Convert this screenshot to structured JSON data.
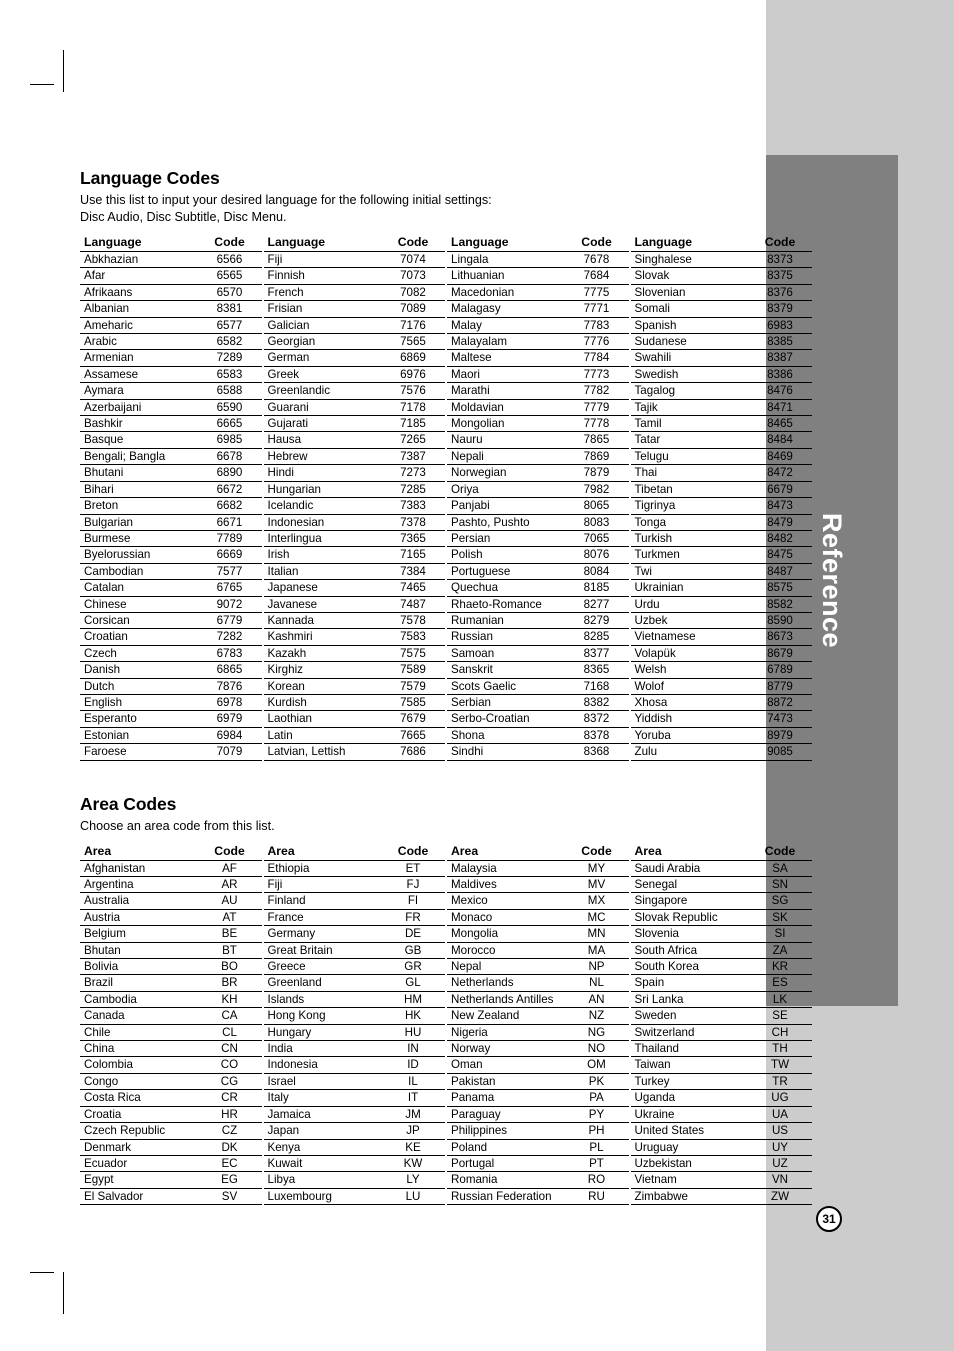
{
  "sidebar": {
    "tab_label": "Reference",
    "page_number": "31"
  },
  "language_section": {
    "title": "Language Codes",
    "description_line1": "Use this list to input your desired language for the following initial settings:",
    "description_line2": "Disc Audio, Disc Subtitle, Disc Menu.",
    "header_name": "Language",
    "header_code": "Code",
    "columns": [
      [
        [
          "Abkhazian",
          "6566"
        ],
        [
          "Afar",
          "6565"
        ],
        [
          "Afrikaans",
          "6570"
        ],
        [
          "Albanian",
          "8381"
        ],
        [
          "Ameharic",
          "6577"
        ],
        [
          "Arabic",
          "6582"
        ],
        [
          "Armenian",
          "7289"
        ],
        [
          "Assamese",
          "6583"
        ],
        [
          "Aymara",
          "6588"
        ],
        [
          "Azerbaijani",
          "6590"
        ],
        [
          "Bashkir",
          "6665"
        ],
        [
          "Basque",
          "6985"
        ],
        [
          "Bengali; Bangla",
          "6678"
        ],
        [
          "Bhutani",
          "6890"
        ],
        [
          "Bihari",
          "6672"
        ],
        [
          "Breton",
          "6682"
        ],
        [
          "Bulgarian",
          "6671"
        ],
        [
          "Burmese",
          "7789"
        ],
        [
          "Byelorussian",
          "6669"
        ],
        [
          "Cambodian",
          "7577"
        ],
        [
          "Catalan",
          "6765"
        ],
        [
          "Chinese",
          "9072"
        ],
        [
          "Corsican",
          "6779"
        ],
        [
          "Croatian",
          "7282"
        ],
        [
          "Czech",
          "6783"
        ],
        [
          "Danish",
          "6865"
        ],
        [
          "Dutch",
          "7876"
        ],
        [
          "English",
          "6978"
        ],
        [
          "Esperanto",
          "6979"
        ],
        [
          "Estonian",
          "6984"
        ],
        [
          "Faroese",
          "7079"
        ]
      ],
      [
        [
          "Fiji",
          "7074"
        ],
        [
          "Finnish",
          "7073"
        ],
        [
          "French",
          "7082"
        ],
        [
          "Frisian",
          "7089"
        ],
        [
          "Galician",
          "7176"
        ],
        [
          "Georgian",
          "7565"
        ],
        [
          "German",
          "6869"
        ],
        [
          "Greek",
          "6976"
        ],
        [
          "Greenlandic",
          "7576"
        ],
        [
          "Guarani",
          "7178"
        ],
        [
          "Gujarati",
          "7185"
        ],
        [
          "Hausa",
          "7265"
        ],
        [
          "Hebrew",
          "7387"
        ],
        [
          "Hindi",
          "7273"
        ],
        [
          "Hungarian",
          "7285"
        ],
        [
          "Icelandic",
          "7383"
        ],
        [
          "Indonesian",
          "7378"
        ],
        [
          "Interlingua",
          "7365"
        ],
        [
          "Irish",
          "7165"
        ],
        [
          "Italian",
          "7384"
        ],
        [
          "Japanese",
          "7465"
        ],
        [
          "Javanese",
          "7487"
        ],
        [
          "Kannada",
          "7578"
        ],
        [
          "Kashmiri",
          "7583"
        ],
        [
          "Kazakh",
          "7575"
        ],
        [
          "Kirghiz",
          "7589"
        ],
        [
          "Korean",
          "7579"
        ],
        [
          "Kurdish",
          "7585"
        ],
        [
          "Laothian",
          "7679"
        ],
        [
          "Latin",
          "7665"
        ],
        [
          "Latvian, Lettish",
          "7686"
        ]
      ],
      [
        [
          "Lingala",
          "7678"
        ],
        [
          "Lithuanian",
          "7684"
        ],
        [
          "Macedonian",
          "7775"
        ],
        [
          "Malagasy",
          "7771"
        ],
        [
          "Malay",
          "7783"
        ],
        [
          "Malayalam",
          "7776"
        ],
        [
          "Maltese",
          "7784"
        ],
        [
          "Maori",
          "7773"
        ],
        [
          "Marathi",
          "7782"
        ],
        [
          "Moldavian",
          "7779"
        ],
        [
          "Mongolian",
          "7778"
        ],
        [
          "Nauru",
          "7865"
        ],
        [
          "Nepali",
          "7869"
        ],
        [
          "Norwegian",
          "7879"
        ],
        [
          "Oriya",
          "7982"
        ],
        [
          "Panjabi",
          "8065"
        ],
        [
          "Pashto, Pushto",
          "8083"
        ],
        [
          "Persian",
          "7065"
        ],
        [
          "Polish",
          "8076"
        ],
        [
          "Portuguese",
          "8084"
        ],
        [
          "Quechua",
          "8185"
        ],
        [
          "Rhaeto-Romance",
          "8277"
        ],
        [
          "Rumanian",
          "8279"
        ],
        [
          "Russian",
          "8285"
        ],
        [
          "Samoan",
          "8377"
        ],
        [
          "Sanskrit",
          "8365"
        ],
        [
          "Scots Gaelic",
          "7168"
        ],
        [
          "Serbian",
          "8382"
        ],
        [
          "Serbo-Croatian",
          "8372"
        ],
        [
          "Shona",
          "8378"
        ],
        [
          "Sindhi",
          "8368"
        ]
      ],
      [
        [
          "Singhalese",
          "8373"
        ],
        [
          "Slovak",
          "8375"
        ],
        [
          "Slovenian",
          "8376"
        ],
        [
          "Somali",
          "8379"
        ],
        [
          "Spanish",
          "6983"
        ],
        [
          "Sudanese",
          "8385"
        ],
        [
          "Swahili",
          "8387"
        ],
        [
          "Swedish",
          "8386"
        ],
        [
          "Tagalog",
          "8476"
        ],
        [
          "Tajik",
          "8471"
        ],
        [
          "Tamil",
          "8465"
        ],
        [
          "Tatar",
          "8484"
        ],
        [
          "Telugu",
          "8469"
        ],
        [
          "Thai",
          "8472"
        ],
        [
          "Tibetan",
          "6679"
        ],
        [
          "Tigrinya",
          "8473"
        ],
        [
          "Tonga",
          "8479"
        ],
        [
          "Turkish",
          "8482"
        ],
        [
          "Turkmen",
          "8475"
        ],
        [
          "Twi",
          "8487"
        ],
        [
          "Ukrainian",
          "8575"
        ],
        [
          "Urdu",
          "8582"
        ],
        [
          "Uzbek",
          "8590"
        ],
        [
          "Vietnamese",
          "8673"
        ],
        [
          "Volapük",
          "8679"
        ],
        [
          "Welsh",
          "6789"
        ],
        [
          "Wolof",
          "8779"
        ],
        [
          "Xhosa",
          "8872"
        ],
        [
          "Yiddish",
          "7473"
        ],
        [
          "Yoruba",
          "8979"
        ],
        [
          "Zulu",
          "9085"
        ]
      ]
    ]
  },
  "area_section": {
    "title": "Area Codes",
    "description_line1": "Choose an area code from this list.",
    "header_name": "Area",
    "header_code": "Code",
    "columns": [
      [
        [
          "Afghanistan",
          "AF"
        ],
        [
          "Argentina",
          "AR"
        ],
        [
          "Australia",
          "AU"
        ],
        [
          "Austria",
          "AT"
        ],
        [
          "Belgium",
          "BE"
        ],
        [
          "Bhutan",
          "BT"
        ],
        [
          "Bolivia",
          "BO"
        ],
        [
          "Brazil",
          "BR"
        ],
        [
          "Cambodia",
          "KH"
        ],
        [
          "Canada",
          "CA"
        ],
        [
          "Chile",
          "CL"
        ],
        [
          "China",
          "CN"
        ],
        [
          "Colombia",
          "CO"
        ],
        [
          "Congo",
          "CG"
        ],
        [
          "Costa Rica",
          "CR"
        ],
        [
          "Croatia",
          "HR"
        ],
        [
          "Czech Republic",
          "CZ"
        ],
        [
          "Denmark",
          "DK"
        ],
        [
          "Ecuador",
          "EC"
        ],
        [
          "Egypt",
          "EG"
        ],
        [
          "El Salvador",
          "SV"
        ]
      ],
      [
        [
          "Ethiopia",
          "ET"
        ],
        [
          "Fiji",
          "FJ"
        ],
        [
          "Finland",
          "FI"
        ],
        [
          "France",
          "FR"
        ],
        [
          "Germany",
          "DE"
        ],
        [
          "Great Britain",
          "GB"
        ],
        [
          "Greece",
          "GR"
        ],
        [
          "Greenland",
          "GL"
        ],
        [
          "Islands",
          "HM"
        ],
        [
          "Hong Kong",
          "HK"
        ],
        [
          "Hungary",
          "HU"
        ],
        [
          "India",
          "IN"
        ],
        [
          "Indonesia",
          "ID"
        ],
        [
          "Israel",
          "IL"
        ],
        [
          "Italy",
          "IT"
        ],
        [
          "Jamaica",
          "JM"
        ],
        [
          "Japan",
          "JP"
        ],
        [
          "Kenya",
          "KE"
        ],
        [
          "Kuwait",
          "KW"
        ],
        [
          "Libya",
          "LY"
        ],
        [
          "Luxembourg",
          "LU"
        ]
      ],
      [
        [
          "Malaysia",
          "MY"
        ],
        [
          "Maldives",
          "MV"
        ],
        [
          "Mexico",
          "MX"
        ],
        [
          "Monaco",
          "MC"
        ],
        [
          "Mongolia",
          "MN"
        ],
        [
          "Morocco",
          "MA"
        ],
        [
          "Nepal",
          "NP"
        ],
        [
          "Netherlands",
          "NL"
        ],
        [
          "Netherlands Antilles",
          "AN"
        ],
        [
          "New Zealand",
          "NZ"
        ],
        [
          "Nigeria",
          "NG"
        ],
        [
          "Norway",
          "NO"
        ],
        [
          "Oman",
          "OM"
        ],
        [
          "Pakistan",
          "PK"
        ],
        [
          "Panama",
          "PA"
        ],
        [
          "Paraguay",
          "PY"
        ],
        [
          "Philippines",
          "PH"
        ],
        [
          "Poland",
          "PL"
        ],
        [
          "Portugal",
          "PT"
        ],
        [
          "Romania",
          "RO"
        ],
        [
          "Russian Federation",
          "RU"
        ]
      ],
      [
        [
          "Saudi Arabia",
          "SA"
        ],
        [
          "Senegal",
          "SN"
        ],
        [
          "Singapore",
          "SG"
        ],
        [
          "Slovak Republic",
          "SK"
        ],
        [
          "Slovenia",
          "SI"
        ],
        [
          "South Africa",
          "ZA"
        ],
        [
          "South Korea",
          "KR"
        ],
        [
          "Spain",
          "ES"
        ],
        [
          "Sri Lanka",
          "LK"
        ],
        [
          "Sweden",
          "SE"
        ],
        [
          "Switzerland",
          "CH"
        ],
        [
          "Thailand",
          "TH"
        ],
        [
          "Taiwan",
          "TW"
        ],
        [
          "Turkey",
          "TR"
        ],
        [
          "Uganda",
          "UG"
        ],
        [
          "Ukraine",
          "UA"
        ],
        [
          "United States",
          "US"
        ],
        [
          "Uruguay",
          "UY"
        ],
        [
          "Uzbekistan",
          "UZ"
        ],
        [
          "Vietnam",
          "VN"
        ],
        [
          "Zimbabwe",
          "ZW"
        ]
      ]
    ]
  }
}
